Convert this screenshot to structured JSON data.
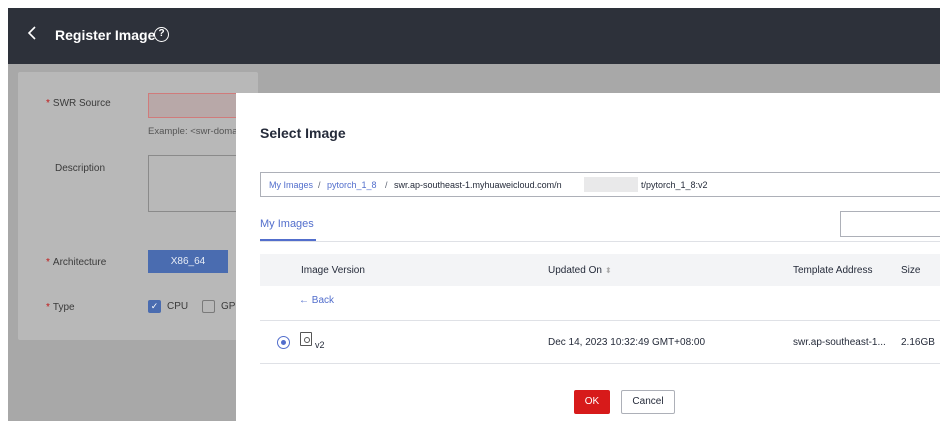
{
  "header": {
    "title": "Register Image",
    "back_icon": "chevron-left-icon",
    "help_icon": "question-circle-icon",
    "help_glyph": "?"
  },
  "form": {
    "required_mark": "*",
    "swr_source": {
      "label": "SWR Source",
      "hint": "Example: <swr-doma"
    },
    "description": {
      "label": "Description"
    },
    "architecture": {
      "label": "Architecture",
      "selected": "X86_64"
    },
    "type": {
      "label": "Type",
      "options": [
        {
          "label": "CPU",
          "checked": true
        },
        {
          "label": "GP",
          "checked": false
        }
      ]
    }
  },
  "dialog": {
    "title": "Select Image",
    "breadcrumb": {
      "root": "My Images",
      "sep": "/",
      "repo": "pytorch_1_8",
      "path_start": "swr.ap-southeast-1.myhuaweicloud.com/n",
      "path_end": "t/pytorch_1_8:v2"
    },
    "tab": "My Images",
    "search": {
      "placeholder": ""
    },
    "table": {
      "columns": [
        "Image Version",
        "Updated On",
        "Template Address",
        "Size"
      ],
      "back_label": "← Back",
      "rows": [
        {
          "version": "v2",
          "updated_on": "Dec 14, 2023 10:32:49 GMT+08:00",
          "template_address": "swr.ap-southeast-1...",
          "size": "2.16GB",
          "selected": true
        }
      ]
    },
    "buttons": {
      "ok": "OK",
      "cancel": "Cancel"
    }
  },
  "colors": {
    "header_bg": "#2d313a",
    "accent": "#526ecc",
    "primary_button": "#d71a1a"
  }
}
